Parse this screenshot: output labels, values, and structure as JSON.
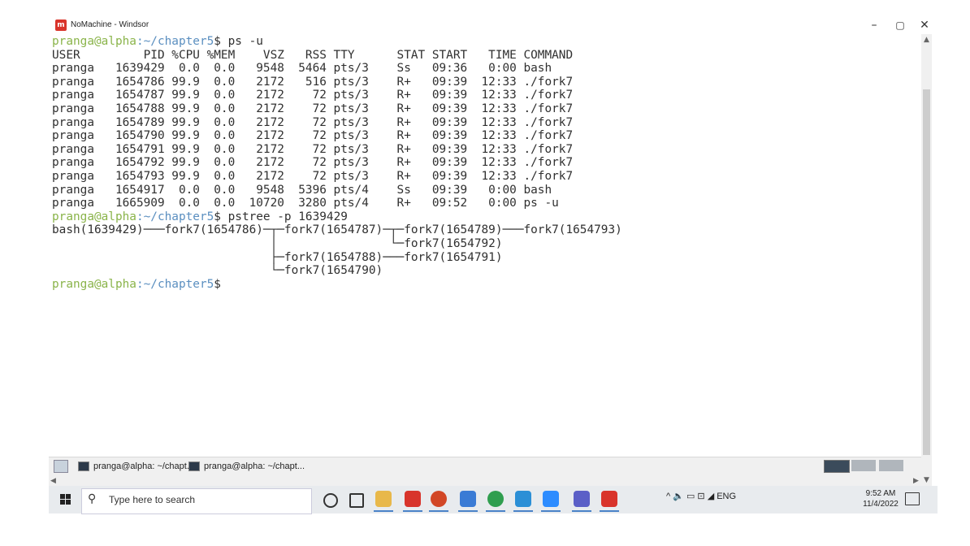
{
  "window": {
    "title": "NoMachine - Windsor",
    "app_icon_text": "m",
    "minimize": "–",
    "maximize": "▢",
    "close": "✕"
  },
  "terminal": {
    "prompt_user": "pranga@alpha",
    "prompt_path": ":~/chapter5",
    "prompt_symbol": "$",
    "command1": " ps -u",
    "ps_header": "USER         PID %CPU %MEM    VSZ   RSS TTY      STAT START   TIME COMMAND",
    "ps_rows": [
      "pranga   1639429  0.0  0.0   9548  5464 pts/3    Ss   09:36   0:00 bash",
      "pranga   1654786 99.9  0.0   2172   516 pts/3    R+   09:39  12:33 ./fork7",
      "pranga   1654787 99.9  0.0   2172    72 pts/3    R+   09:39  12:33 ./fork7",
      "pranga   1654788 99.9  0.0   2172    72 pts/3    R+   09:39  12:33 ./fork7",
      "pranga   1654789 99.9  0.0   2172    72 pts/3    R+   09:39  12:33 ./fork7",
      "pranga   1654790 99.9  0.0   2172    72 pts/3    R+   09:39  12:33 ./fork7",
      "pranga   1654791 99.9  0.0   2172    72 pts/3    R+   09:39  12:33 ./fork7",
      "pranga   1654792 99.9  0.0   2172    72 pts/3    R+   09:39  12:33 ./fork7",
      "pranga   1654793 99.9  0.0   2172    72 pts/3    R+   09:39  12:33 ./fork7",
      "pranga   1654917  0.0  0.0   9548  5396 pts/4    Ss   09:39   0:00 bash",
      "pranga   1665909  0.0  0.0  10720  3280 pts/4    R+   09:52   0:00 ps -u"
    ],
    "command2": " pstree -p 1639429",
    "pstree_lines": [
      "bash(1639429)───fork7(1654786)─┬─fork7(1654787)─┬─fork7(1654789)───fork7(1654793)",
      "                               │                └─fork7(1654792)",
      "                               ├─fork7(1654788)───fork7(1654791)",
      "                               └─fork7(1654790)"
    ]
  },
  "task_strip": {
    "items": [
      "pranga@alpha: ~/chapt...",
      "pranga@alpha: ~/chapt..."
    ]
  },
  "taskbar": {
    "search_placeholder": "Type here to search",
    "tray_text": "^  🔈  ▭  ⊡  ◢  ENG",
    "time": "9:52 AM",
    "date": "11/4/2022",
    "icons": [
      {
        "name": "cortana-icon",
        "color": "#333333"
      },
      {
        "name": "task-view-icon",
        "color": "#333333"
      },
      {
        "name": "file-explorer-icon",
        "color": "#e8b84a"
      },
      {
        "name": "acrobat-icon",
        "color": "#d8342b"
      },
      {
        "name": "powerpoint-icon",
        "color": "#d24726"
      },
      {
        "name": "notepad-icon",
        "color": "#3a7bd5"
      },
      {
        "name": "chrome-icon",
        "color": "#2f9e4f"
      },
      {
        "name": "edge-icon",
        "color": "#2b8fd6"
      },
      {
        "name": "zoom-icon",
        "color": "#2d8cff"
      },
      {
        "name": "teams-icon",
        "color": "#5b5fc7"
      },
      {
        "name": "nomachine-icon",
        "color": "#d9342b"
      }
    ]
  }
}
